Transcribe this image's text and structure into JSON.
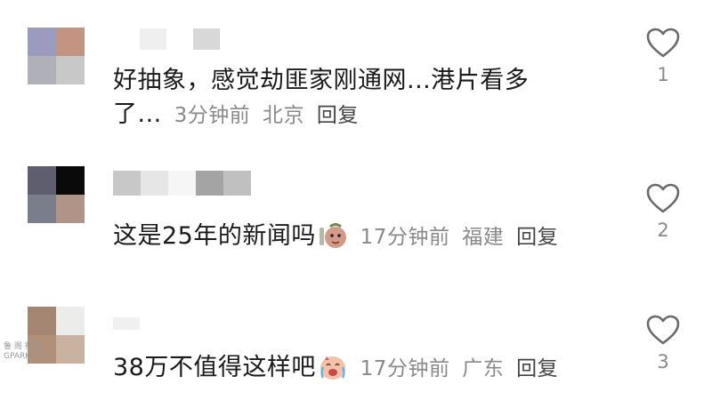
{
  "comments": [
    {
      "text_line1": "好抽象，感觉劫匪家刚通网...港片看多",
      "text_line2": "了...",
      "time": "3分钟前",
      "location": "北京",
      "reply": "回复",
      "likes": "1",
      "avatar_colors": [
        "#9b9bc0",
        "#c49482",
        "#b0b0b8",
        "#c8c8c8"
      ],
      "name_colors": [
        "#efefef",
        "#d8d8d8"
      ]
    },
    {
      "text": "这是25年的新闻吗",
      "emoji": "character-emoji",
      "time": "17分钟前",
      "location": "福建",
      "reply": "回复",
      "likes": "2",
      "avatar_colors": [
        "#5e5e6e",
        "#0a0a0a",
        "#7a7d8a",
        "#b09488"
      ],
      "name_colors": [
        "#c8c8c8",
        "#e6e6e6",
        "#f4f4f4",
        "#a4a4a4",
        "#c0c0c0"
      ]
    },
    {
      "text": "38万不值得这样吧",
      "emoji": "crying-laugh-emoji",
      "time": "17分钟前",
      "location": "广东",
      "reply": "回复",
      "likes": "3",
      "avatar_colors": [
        "#a48672",
        "#ececea",
        "#b09078",
        "#c9b3a0"
      ],
      "name_colors": [
        "#e8e8e8"
      ]
    }
  ],
  "watermark": {
    "line1": "鲁 阁 社 区",
    "line2": "GPARK.com"
  }
}
